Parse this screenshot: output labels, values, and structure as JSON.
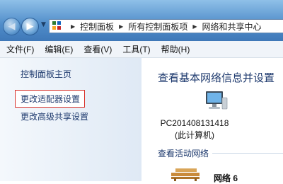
{
  "addressbar": {
    "crumbs": [
      "控制面板",
      "所有控制面板项",
      "网络和共享中心"
    ]
  },
  "menubar": {
    "items": [
      "文件(F)",
      "编辑(E)",
      "查看(V)",
      "工具(T)",
      "帮助(H)"
    ]
  },
  "sidebar": {
    "home_label": "控制面板主页",
    "adapter_label": "更改适配器设置",
    "sharing_label": "更改高级共享设置"
  },
  "main": {
    "title": "查看基本网络信息并设置",
    "computer_name": "PC201408131418",
    "computer_sub": "(此计算机)",
    "active_networks_label": "查看活动网络",
    "network_name": "网络 6"
  },
  "colors": {
    "link": "#1e3a6e",
    "highlight_border": "#d8322b",
    "titlebar": "#4f8cc9"
  },
  "icons": {
    "back": "arrow-left-icon",
    "forward": "arrow-right-icon",
    "control_panel": "control-panel-icon",
    "computer": "computer-icon",
    "network": "network-bench-icon"
  }
}
